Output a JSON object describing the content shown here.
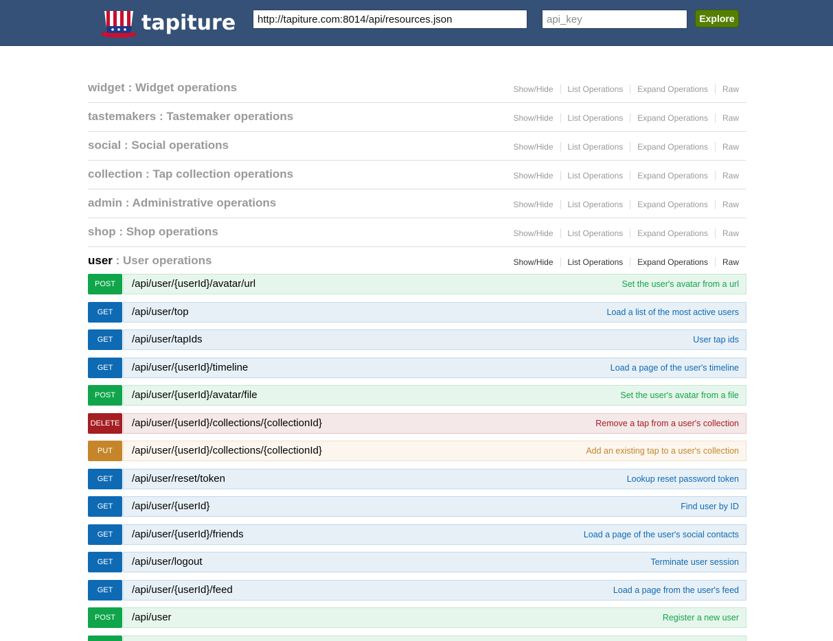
{
  "header": {
    "logo_text": "tapiture",
    "url_value": "http://tapiture.com:8014/api/resources.json",
    "api_key_placeholder": "api_key",
    "explore_label": "Explore",
    "colors": {
      "bar": "#365177",
      "explore": "#547f00"
    }
  },
  "resources": [
    {
      "name": "widget",
      "sep": " : ",
      "desc": "Widget operations",
      "links": [
        "Show/Hide",
        "List Operations",
        "Expand Operations",
        "Raw"
      ]
    },
    {
      "name": "tastemakers",
      "sep": " : ",
      "desc": "Tastemaker operations",
      "links": [
        "Show/Hide",
        "List Operations",
        "Expand Operations",
        "Raw"
      ]
    },
    {
      "name": "social",
      "sep": " : ",
      "desc": "Social operations",
      "links": [
        "Show/Hide",
        "List Operations",
        "Expand Operations",
        "Raw"
      ]
    },
    {
      "name": "collection",
      "sep": " : ",
      "desc": "Tap collection operations",
      "links": [
        "Show/Hide",
        "List Operations",
        "Expand Operations",
        "Raw"
      ]
    },
    {
      "name": "admin",
      "sep": " : ",
      "desc": "Administrative operations",
      "links": [
        "Show/Hide",
        "List Operations",
        "Expand Operations",
        "Raw"
      ]
    },
    {
      "name": "shop",
      "sep": " : ",
      "desc": "Shop operations",
      "links": [
        "Show/Hide",
        "List Operations",
        "Expand Operations",
        "Raw"
      ]
    },
    {
      "name": "user",
      "sep": " : ",
      "desc": "User operations",
      "links": [
        "Show/Hide",
        "List Operations",
        "Expand Operations",
        "Raw"
      ]
    }
  ],
  "operations": [
    {
      "method": "POST",
      "path": "/api/user/{userId}/avatar/url",
      "desc": "Set the user's avatar from a url"
    },
    {
      "method": "GET",
      "path": "/api/user/top",
      "desc": "Load a list of the most active users"
    },
    {
      "method": "GET",
      "path": "/api/user/tapIds",
      "desc": "User tap ids"
    },
    {
      "method": "GET",
      "path": "/api/user/{userId}/timeline",
      "desc": "Load a page of the user's timeline"
    },
    {
      "method": "POST",
      "path": "/api/user/{userId}/avatar/file",
      "desc": "Set the user's avatar from a file"
    },
    {
      "method": "DELETE",
      "path": "/api/user/{userId}/collections/{collectionId}",
      "desc": "Remove a tap from a user's collection"
    },
    {
      "method": "PUT",
      "path": "/api/user/{userId}/collections/{collectionId}",
      "desc": "Add an existing tap to a user's collection"
    },
    {
      "method": "GET",
      "path": "/api/user/reset/token",
      "desc": "Lookup reset password token"
    },
    {
      "method": "GET",
      "path": "/api/user/{userId}",
      "desc": "Find user by ID"
    },
    {
      "method": "GET",
      "path": "/api/user/{userId}/friends",
      "desc": "Load a page of the user's social contacts"
    },
    {
      "method": "GET",
      "path": "/api/user/logout",
      "desc": "Terminate user session"
    },
    {
      "method": "GET",
      "path": "/api/user/{userId}/feed",
      "desc": "Load a page from the user's feed"
    },
    {
      "method": "POST",
      "path": "/api/user",
      "desc": "Register a new user"
    }
  ],
  "method_colors": {
    "GET": "#0f6ab4",
    "POST": "#10a54a",
    "DELETE": "#a41e22",
    "PUT": "#c5862b"
  }
}
